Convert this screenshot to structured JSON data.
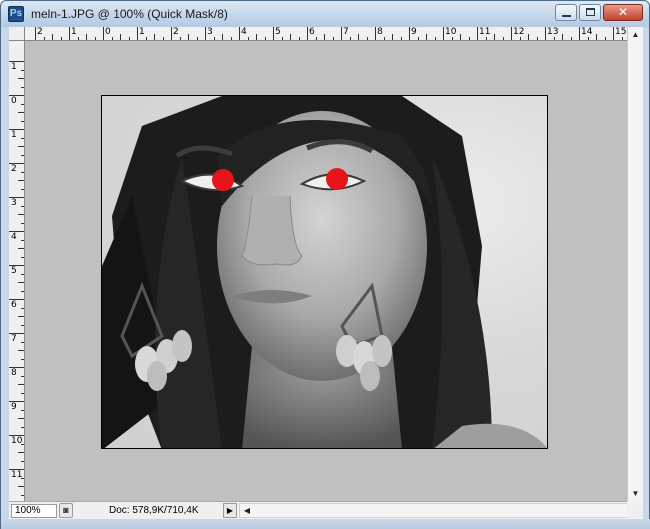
{
  "window": {
    "title": "meln-1.JPG @ 100% (Quick Mask/8)",
    "app_icon": "photoshop-icon",
    "close_glyph": "✕"
  },
  "rulers": {
    "top_labels": [
      "2",
      "1",
      "0",
      "1",
      "2",
      "3",
      "4",
      "5",
      "6",
      "7",
      "8",
      "9",
      "10",
      "11",
      "12",
      "13",
      "14",
      "15"
    ],
    "left_labels": [
      "1",
      "0",
      "1",
      "2",
      "3",
      "4",
      "5",
      "6",
      "7",
      "8",
      "9",
      "10",
      "11"
    ]
  },
  "document": {
    "image_description_icon": "portrait-photo",
    "mask_color": "#e8141b"
  },
  "statusbar": {
    "zoom": "100%",
    "doc_info": "Doc: 578,9K/710,4K",
    "arrow_glyph": "▶",
    "left_arrow": "◀",
    "right_arrow": "▶"
  },
  "scrollbar": {
    "up_arrow": "▲",
    "down_arrow": "▼"
  }
}
